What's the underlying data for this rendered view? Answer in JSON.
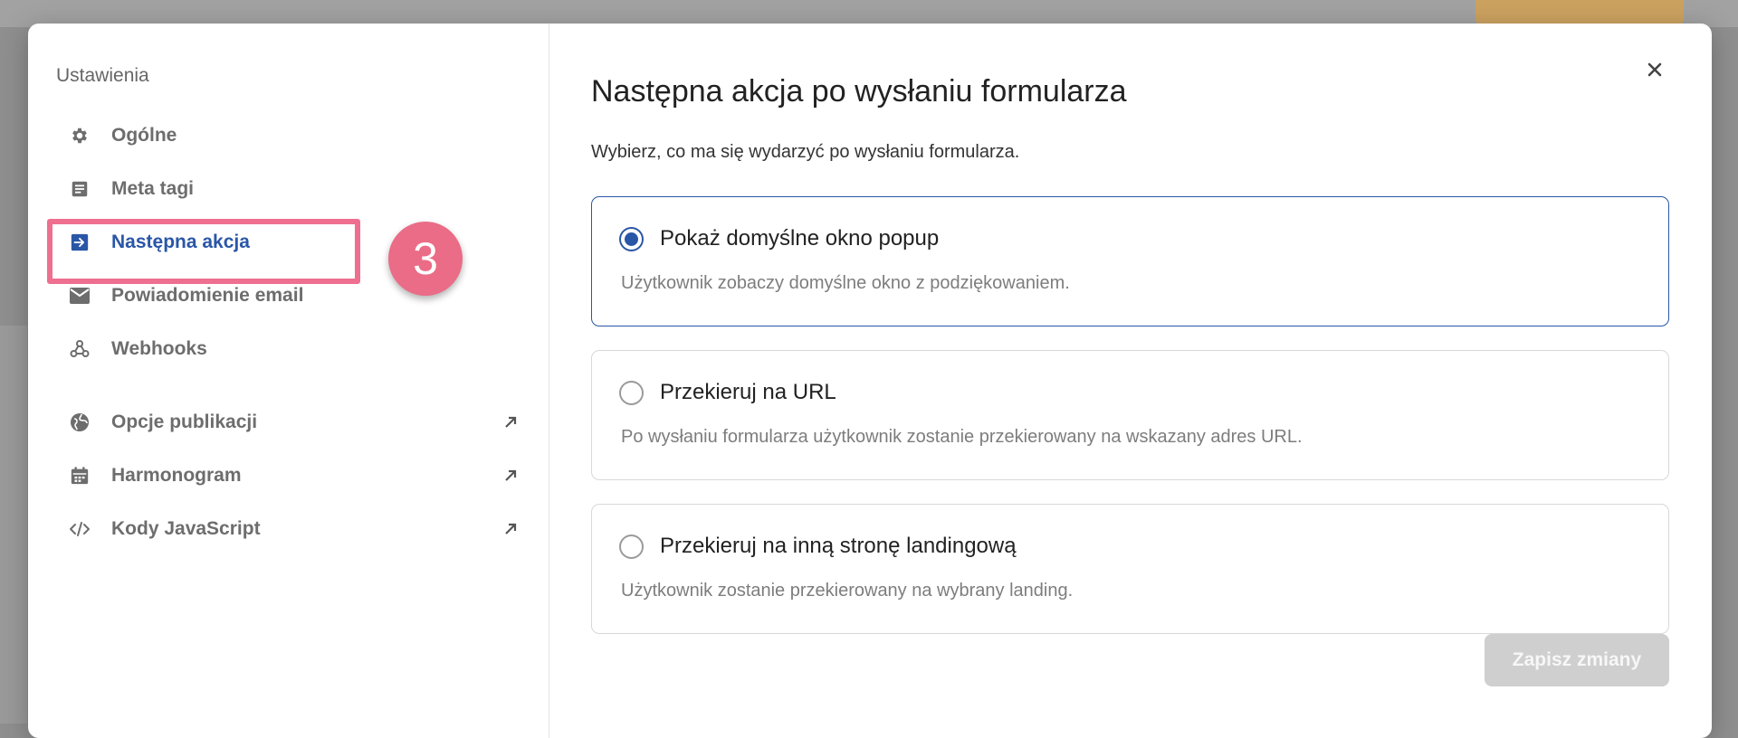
{
  "sidebar": {
    "title": "Ustawienia",
    "items": [
      {
        "label": "Ogólne",
        "icon": "gear-icon"
      },
      {
        "label": "Meta tagi",
        "icon": "document-icon"
      },
      {
        "label": "Następna akcja",
        "icon": "arrow-right-box-icon",
        "active": true
      },
      {
        "label": "Powiadomienie email",
        "icon": "envelope-icon"
      },
      {
        "label": "Webhooks",
        "icon": "webhook-icon"
      }
    ],
    "external_items": [
      {
        "label": "Opcje publikacji",
        "icon": "globe-icon"
      },
      {
        "label": "Harmonogram",
        "icon": "calendar-icon"
      },
      {
        "label": "Kody JavaScript",
        "icon": "code-icon"
      }
    ]
  },
  "annotation": {
    "step_number": "3"
  },
  "main": {
    "title": "Następna akcja po wysłaniu formularza",
    "subtitle": "Wybierz, co ma się wydarzyć po wysłaniu formularza.",
    "options": [
      {
        "label": "Pokaż domyślne okno popup",
        "description": "Użytkownik zobaczy domyślne okno z podziękowaniem.",
        "selected": true
      },
      {
        "label": "Przekieruj na URL",
        "description": "Po wysłaniu formularza użytkownik zostanie przekierowany na wskazany adres URL.",
        "selected": false
      },
      {
        "label": "Przekieruj na inną stronę landingową",
        "description": "Użytkownik zostanie przekierowany na wybrany landing.",
        "selected": false
      }
    ],
    "save_label": "Zapisz zmiany"
  },
  "colors": {
    "accent": "#2a56a7",
    "highlight": "#ee6f8f",
    "badge": "#ea6c86",
    "disabled_button": "#cfcfcf"
  }
}
